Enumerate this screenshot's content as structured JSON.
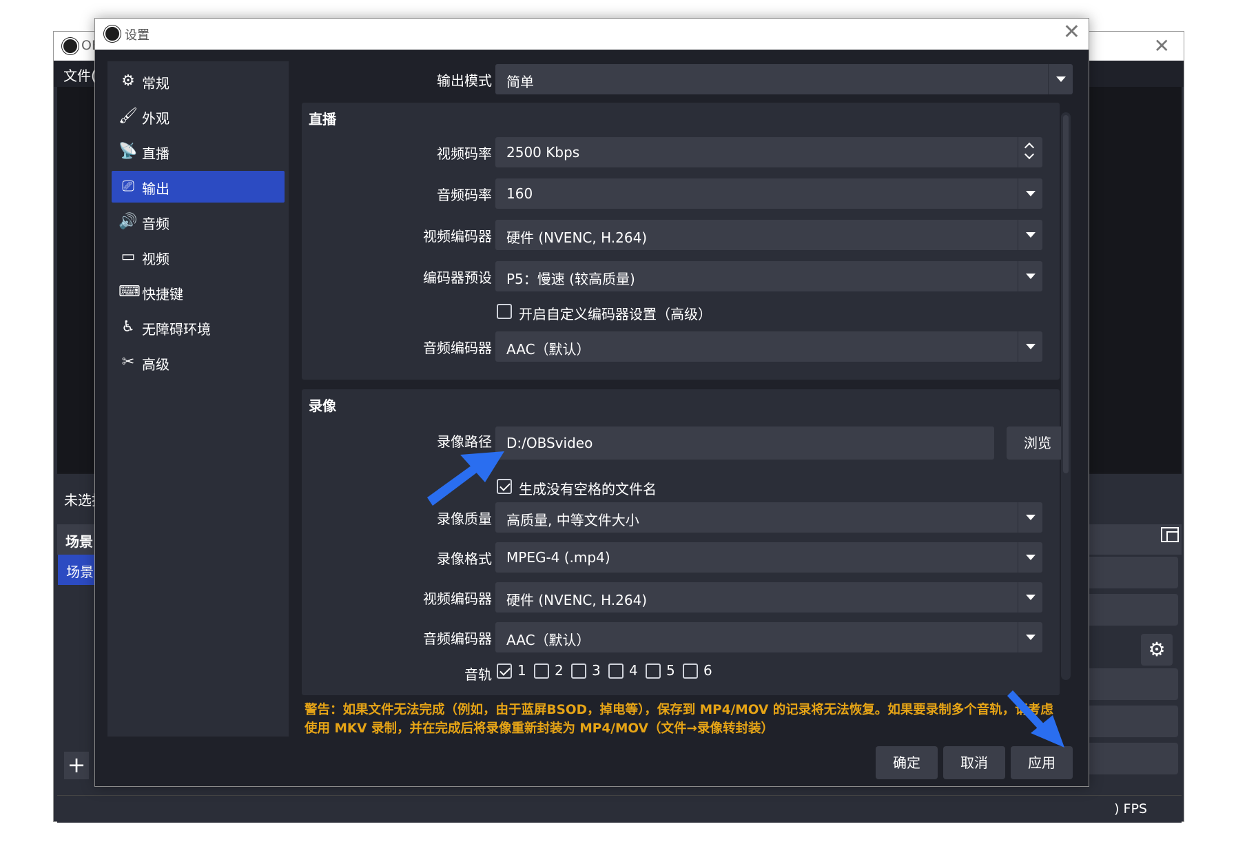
{
  "main_window": {
    "title": "OBS",
    "menu_file": "文件(F",
    "no_source_selected": "未选择",
    "scenes_header": "场景",
    "scene_item": "场景",
    "fps_label": ") FPS"
  },
  "dialog": {
    "title": "设置",
    "sidebar": [
      {
        "label": "常规",
        "icon": "gear-icon"
      },
      {
        "label": "外观",
        "icon": "appearance-icon"
      },
      {
        "label": "直播",
        "icon": "antenna-icon"
      },
      {
        "label": "输出",
        "icon": "output-icon",
        "active": true
      },
      {
        "label": "音频",
        "icon": "speaker-icon"
      },
      {
        "label": "视频",
        "icon": "monitor-icon"
      },
      {
        "label": "快捷键",
        "icon": "keyboard-icon"
      },
      {
        "label": "无障碍环境",
        "icon": "accessibility-icon"
      },
      {
        "label": "高级",
        "icon": "tools-icon"
      }
    ],
    "output_mode": {
      "label": "输出模式",
      "value": "简单"
    },
    "streaming": {
      "title": "直播",
      "video_bitrate": {
        "label": "视频码率",
        "value": "2500 Kbps"
      },
      "audio_bitrate": {
        "label": "音频码率",
        "value": "160"
      },
      "video_encoder": {
        "label": "视频编码器",
        "value": "硬件 (NVENC, H.264)"
      },
      "encoder_preset": {
        "label": "编码器预设",
        "value": "P5：慢速 (较高质量)"
      },
      "custom_encoder_settings": {
        "label": "开启自定义编码器设置（高级）",
        "checked": false
      },
      "audio_encoder": {
        "label": "音频编码器",
        "value": "AAC（默认）"
      }
    },
    "recording": {
      "title": "录像",
      "path": {
        "label": "录像路径",
        "value": "D:/OBSvideo",
        "browse": "浏览"
      },
      "no_space_filename": {
        "label": "生成没有空格的文件名",
        "checked": true
      },
      "quality": {
        "label": "录像质量",
        "value": "高质量, 中等文件大小"
      },
      "format": {
        "label": "录像格式",
        "value": "MPEG-4 (.mp4)"
      },
      "video_encoder": {
        "label": "视频编码器",
        "value": "硬件 (NVENC, H.264)"
      },
      "audio_encoder": {
        "label": "音频编码器",
        "value": "AAC（默认）"
      },
      "tracks": {
        "label": "音轨",
        "items": [
          {
            "n": "1",
            "checked": true
          },
          {
            "n": "2",
            "checked": false
          },
          {
            "n": "3",
            "checked": false
          },
          {
            "n": "4",
            "checked": false
          },
          {
            "n": "5",
            "checked": false
          },
          {
            "n": "6",
            "checked": false
          }
        ]
      }
    },
    "warning": "警告：如果文件无法完成（例如，由于蓝屏BSOD，掉电等），保存到 MP4/MOV 的记录将无法恢复。如果要录制多个音轨，请考虑使用 MKV 录制，并在完成后将录像重新封装为 MP4/MOV（文件→录像转封装）",
    "buttons": {
      "ok": "确定",
      "cancel": "取消",
      "apply": "应用"
    }
  },
  "colors": {
    "accent": "#2c4bc2",
    "dialog_bg": "#1f2129",
    "panel_bg": "#2b2e38",
    "control_bg": "#3b3e49",
    "warning": "#e6a416",
    "annotation_arrow": "#2a6ef0"
  }
}
